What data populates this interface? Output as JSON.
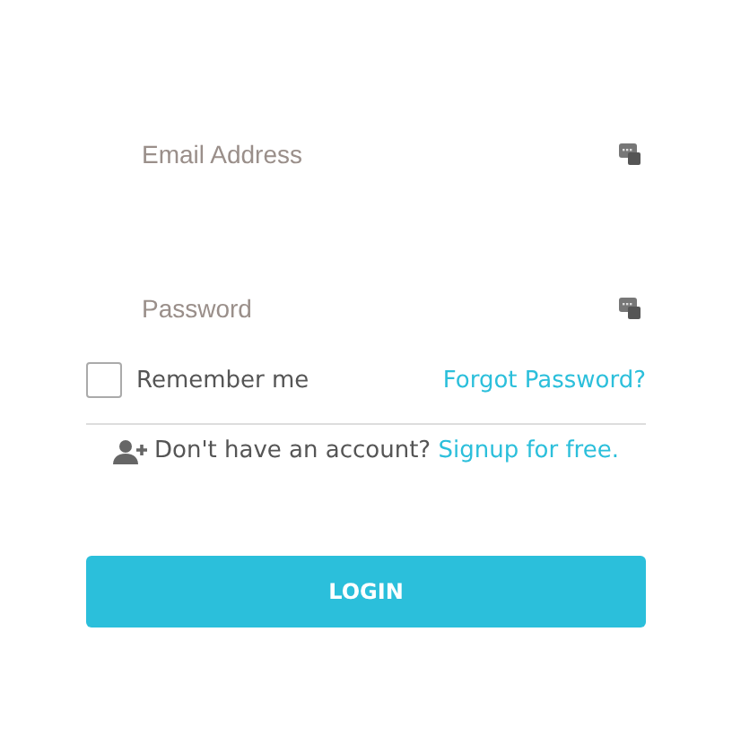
{
  "fields": [
    {
      "placeholder": "Email Address"
    },
    {
      "placeholder": "Password"
    }
  ],
  "remember": {
    "label": "Remember me",
    "checked": false
  },
  "forgot_link": "Forgot Password?",
  "signup": {
    "prompt": "Don't have an account?",
    "link": "Signup for free."
  },
  "login_button": "LOGIN"
}
